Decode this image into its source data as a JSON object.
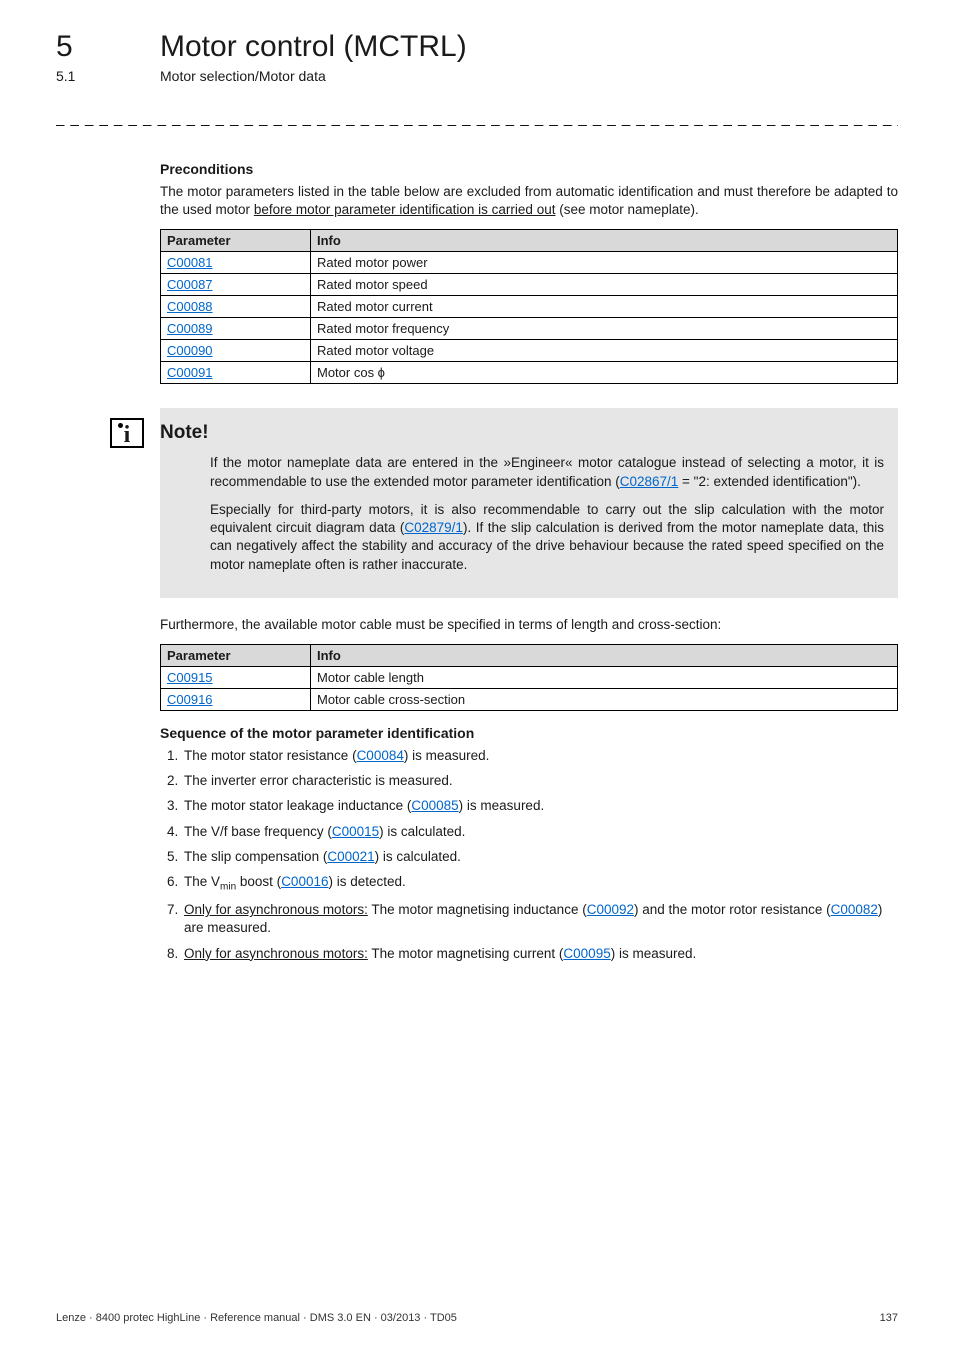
{
  "header": {
    "chapter_num": "5",
    "chapter_title": "Motor control (MCTRL)",
    "sub_num": "5.1",
    "sub_title": "Motor selection/Motor data"
  },
  "preconditions": {
    "heading": "Preconditions",
    "intro_a": "The motor parameters listed in the table below are excluded from automatic identification and must therefore be adapted to the used motor ",
    "intro_u": "before motor parameter identification is carried out",
    "intro_b": " (see motor nameplate).",
    "table_headers": {
      "col1": "Parameter",
      "col2": "Info"
    },
    "rows": [
      {
        "code": "C00081",
        "info": "Rated motor power"
      },
      {
        "code": "C00087",
        "info": "Rated motor speed"
      },
      {
        "code": "C00088",
        "info": "Rated motor current"
      },
      {
        "code": "C00089",
        "info": "Rated motor frequency"
      },
      {
        "code": "C00090",
        "info": "Rated motor voltage"
      },
      {
        "code": "C00091",
        "info": "Motor cos ϕ"
      }
    ]
  },
  "note": {
    "title": "Note!",
    "p1_a": "If the motor nameplate data are entered in the »Engineer« motor catalogue instead of selecting a motor, it is recommendable to use the extended motor parameter identification (",
    "p1_link": "C02867/1",
    "p1_b": " = \"2: extended identification\").",
    "p2_a": "Especially for third-party motors, it is also recommendable to carry out the slip calculation with the motor equivalent circuit diagram data (",
    "p2_link": "C02879/1",
    "p2_b": "). If the slip calculation is derived from the motor nameplate data, this can negatively affect the stability and accuracy of the drive behaviour because the rated speed specified on the motor nameplate often is rather inaccurate."
  },
  "cable": {
    "intro": "Furthermore, the available motor cable must be specified in terms of length and cross-section:",
    "table_headers": {
      "col1": "Parameter",
      "col2": "Info"
    },
    "rows": [
      {
        "code": "C00915",
        "info": "Motor cable length"
      },
      {
        "code": "C00916",
        "info": "Motor cable cross-section"
      }
    ]
  },
  "sequence": {
    "heading": "Sequence of the motor parameter identification",
    "items": {
      "i1_a": "The motor stator resistance (",
      "i1_link": "C00084",
      "i1_b": ") is measured.",
      "i2": "The inverter error characteristic is measured.",
      "i3_a": "The motor stator leakage inductance (",
      "i3_link": "C00085",
      "i3_b": ") is measured.",
      "i4_a": "The V/f base frequency (",
      "i4_link": "C00015",
      "i4_b": ") is calculated.",
      "i5_a": "The slip compensation (",
      "i5_link": "C00021",
      "i5_b": ") is calculated.",
      "i6_a": "The V",
      "i6_sub": "min",
      "i6_b": " boost (",
      "i6_link": "C00016",
      "i6_c": ") is detected.",
      "i7_u": "Only for asynchronous motors:",
      "i7_a": " The motor magnetising inductance (",
      "i7_link1": "C00092",
      "i7_b": ") and the motor rotor resistance (",
      "i7_link2": "C00082",
      "i7_c": ") are measured.",
      "i8_u": "Only for asynchronous motors:",
      "i8_a": " The motor magnetising current (",
      "i8_link": "C00095",
      "i8_b": ") is measured."
    }
  },
  "footer": {
    "left": "Lenze · 8400 protec HighLine · Reference manual · DMS 3.0 EN · 03/2013 · TD05",
    "right": "137"
  }
}
